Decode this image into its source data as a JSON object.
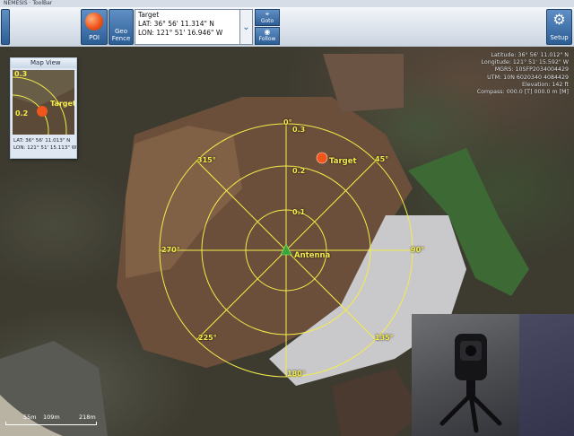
{
  "window": {
    "title": "NEMESIS · ToolBar"
  },
  "toolbar": {
    "poi_label": "POI",
    "geofence_label": "Geo Fence",
    "target_title": "Target",
    "target_lat": "LAT: 36° 56' 11.314\" N",
    "target_lon": "LON: 121° 51' 16.946\" W",
    "goto_label": "Goto",
    "follow_label": "Follow",
    "setup_label": "Setup"
  },
  "mapview": {
    "title": "Map View",
    "ring_outer": "0.3",
    "ring_inner": "0.2",
    "target_label": "Target",
    "lat": "LAT: 36° 56' 11.013\" N",
    "lon": "LON: 121° 51' 15.113\" W"
  },
  "coords": {
    "latitude": "Latitude: 36° 56' 11.012\" N",
    "longitude": "Longitude: 121° 51' 15.592\" W",
    "mgrs": "MGRS: 10SFP2034004429",
    "utm": "UTM: 10N 6020340 4084429",
    "elevation": "Elevation: 142 ft",
    "compass": "Compass: 000.0 [T] 000.0 m [M]"
  },
  "radar": {
    "bearings": [
      "0°",
      "45°",
      "90°",
      "135°",
      "180°",
      "225°",
      "270°",
      "315°"
    ],
    "rings": [
      "0.1",
      "0.2",
      "0.3"
    ],
    "antenna_label": "Antenna",
    "target_label": "Target"
  },
  "scale": {
    "labels": [
      "55m",
      "109m",
      "218m"
    ]
  },
  "colors": {
    "overlay": "#f4ec4a",
    "toolbar_blue": "#2c5e96",
    "marker": "#f0561c"
  }
}
